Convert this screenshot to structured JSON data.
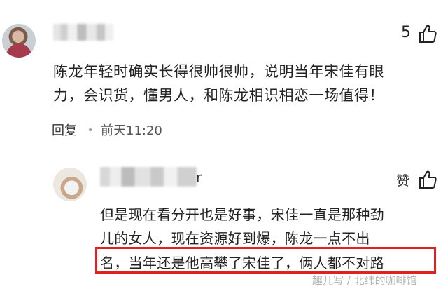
{
  "comment": {
    "like_count": "5",
    "like_icon": "thumbs-up-icon",
    "lines": [
      "陈龙年轻时确实长得很帅很帅，说明当年宋佳有眼",
      "力，会识货，懂男人，和陈龙相识相恋一场值得！"
    ],
    "reply_label": "回复",
    "time": "前天11:20"
  },
  "reply": {
    "name_tail": "r",
    "like_label": "赞",
    "like_icon": "thumbs-up-icon",
    "lines": [
      "但是现在看分开也是好事，宋佳一直是那种劲",
      "儿的女人，现在资源好到爆，陈龙一点不出",
      "名，当年还是他高攀了宋佳了，俩人都不对路"
    ]
  },
  "watermark": "趣儿写 / 北纬的咖啡馆",
  "colors": {
    "highlight_border": "#e0211f",
    "text": "#222222",
    "meta": "#555555"
  }
}
